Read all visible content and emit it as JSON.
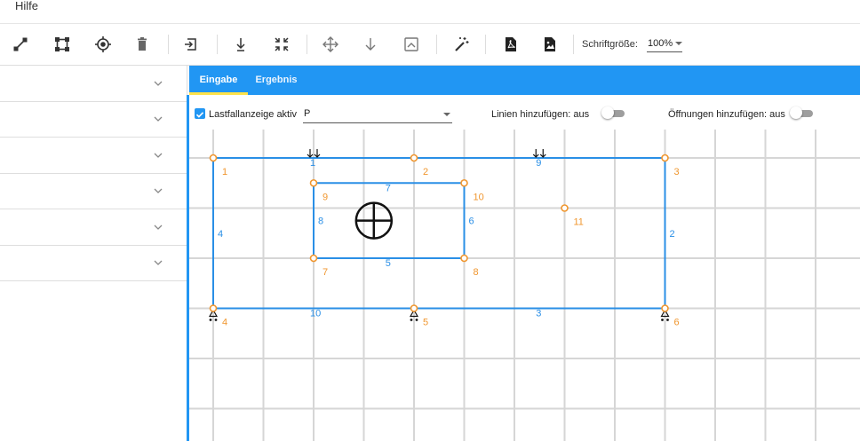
{
  "menu": {
    "help": "Hilfe"
  },
  "toolbar": {
    "tools": [
      {
        "name": "draw-line-icon"
      },
      {
        "name": "rectangle-tool-icon"
      },
      {
        "name": "point-target-icon"
      },
      {
        "name": "delete-icon"
      },
      {
        "name": "import-icon"
      },
      {
        "name": "point-load-icon"
      },
      {
        "name": "compress-icon"
      },
      {
        "name": "move-icon"
      },
      {
        "name": "arrow-down-icon"
      },
      {
        "name": "image-frame-icon"
      },
      {
        "name": "magic-wand-icon"
      },
      {
        "name": "pdf-export-icon"
      },
      {
        "name": "image-export-icon"
      }
    ],
    "font_size_label": "Schriftgröße:",
    "font_size_value": "100%"
  },
  "sidebar": {
    "items": [
      "",
      "",
      "",
      "",
      "",
      ""
    ]
  },
  "tabs": [
    {
      "label": "Eingabe",
      "active": true
    },
    {
      "label": "Ergebnis",
      "active": false
    }
  ],
  "options": {
    "load_case_display_label": "Lastfallanzeige aktiv",
    "load_case_display_checked": true,
    "load_case_value": "P",
    "add_lines_label": "Linien hinzufügen: aus",
    "add_openings_label": "Öffnungen hinzufügen: aus"
  },
  "colors": {
    "accent": "#2196f3",
    "node": "#f0962e",
    "line": "#2a8fe6",
    "grid": "#d6d6d6",
    "tab_indicator": "#ffe24a"
  },
  "model": {
    "nodes": [
      {
        "id": "1",
        "x": 0,
        "y": 0
      },
      {
        "id": "2",
        "x": 4,
        "y": 0
      },
      {
        "id": "3",
        "x": 9,
        "y": 0
      },
      {
        "id": "4",
        "x": 0,
        "y": 3
      },
      {
        "id": "5",
        "x": 4,
        "y": 3
      },
      {
        "id": "6",
        "x": 9,
        "y": 3
      },
      {
        "id": "7",
        "x": 2,
        "y": 2
      },
      {
        "id": "8",
        "x": 5,
        "y": 2
      },
      {
        "id": "9",
        "x": 2,
        "y": 0.5
      },
      {
        "id": "10",
        "x": 5,
        "y": 0.5
      },
      {
        "id": "11",
        "x": 7,
        "y": 1
      }
    ],
    "lines": [
      {
        "id": "1",
        "from": "1",
        "to": "2"
      },
      {
        "id": "9",
        "from": "2",
        "to": "3"
      },
      {
        "id": "2",
        "from": "3",
        "to": "6"
      },
      {
        "id": "3",
        "from": "5",
        "to": "6"
      },
      {
        "id": "10",
        "from": "4",
        "to": "5"
      },
      {
        "id": "4",
        "from": "1",
        "to": "4"
      },
      {
        "id": "7",
        "from": "9",
        "to": "10"
      },
      {
        "id": "5",
        "from": "7",
        "to": "8"
      },
      {
        "id": "8",
        "from": "9",
        "to": "7"
      },
      {
        "id": "6",
        "from": "10",
        "to": "8"
      }
    ],
    "supports": [
      "4",
      "5",
      "6"
    ],
    "loads_on_lines": [
      "1",
      "9"
    ],
    "centroid": {
      "x": 3.2,
      "y": 1.25
    }
  }
}
